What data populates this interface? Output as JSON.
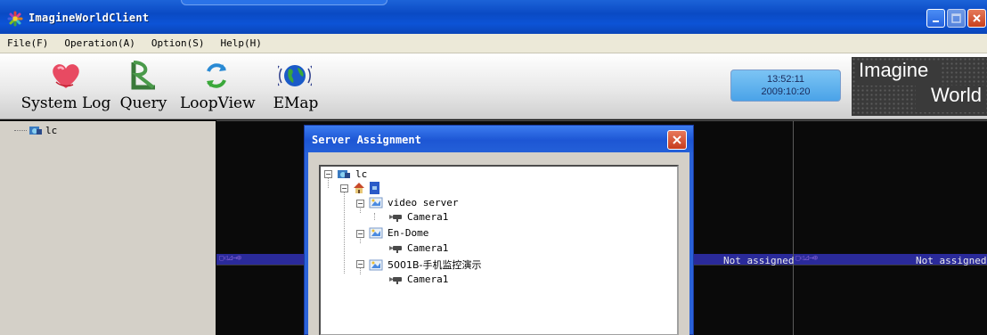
{
  "window": {
    "title": "ImagineWorldClient"
  },
  "menu": {
    "items": [
      "File(F)",
      "Operation(A)",
      "Option(S)",
      "Help(H)"
    ]
  },
  "toolbar": {
    "tools": [
      {
        "label": "System Log",
        "icon": "heart-icon"
      },
      {
        "label": "Query",
        "icon": "query-icon"
      },
      {
        "label": "LoopView",
        "icon": "loop-arrows-icon"
      },
      {
        "label": "EMap",
        "icon": "globe-icon"
      }
    ],
    "clock": {
      "time": "13:52:11",
      "date": "2009:10:20"
    },
    "logo": {
      "line1": "Imagine",
      "line2": "World"
    }
  },
  "left_tree": {
    "root_label": "lc"
  },
  "video": {
    "not_assigned_1": "Not assigned",
    "not_assigned_2": "Not assigned"
  },
  "dialog": {
    "title": "Server Assignment",
    "tree": {
      "root": "lc",
      "servers": [
        {
          "name": "video server",
          "camera": "Camera1"
        },
        {
          "name": "En-Dome",
          "camera": "Camera1"
        },
        {
          "name": "5001B-手机监控演示",
          "camera": "Camera1"
        }
      ]
    }
  },
  "colors": {
    "titlebar": "#0a4ac4",
    "clock_bg": "#4aa3e8",
    "dialog_frame": "#2a62d8"
  }
}
